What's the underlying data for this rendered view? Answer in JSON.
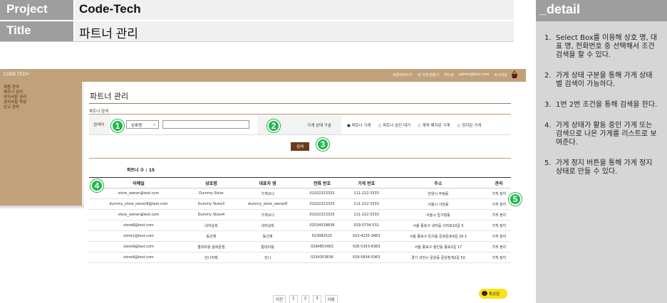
{
  "header": {
    "project_key": "Project",
    "project_val": "Code-Tech",
    "title_key": "Title",
    "title_val": "파트너 관리"
  },
  "detail": {
    "title": "_detail",
    "items": [
      {
        "num": "1.",
        "text": "Select Box를 이용해 상호 명, 대표 명, 전화번호 중 선택해서 조건 검색을 할 수 있다."
      },
      {
        "num": "2.",
        "text": "가게 상태 구분을 통해 가게 상태 별 검색이 가능하다."
      },
      {
        "num": "3.",
        "text": "1번 2번 조건을 통해 검색을 한다."
      },
      {
        "num": "4.",
        "text": "가게 상태가 활동 중인 가게 또는 검색으로 나온 가게를 리스트로 보여준다."
      },
      {
        "num": "5.",
        "text": "가게 정지 버튼을 통해 가게 정지 상태로 만들 수 있다."
      }
    ]
  },
  "app": {
    "brand": "CODE TECH",
    "nav": [
      "주문하러가기",
      "내 가게 만들기",
      "여드런",
      "admin@test.com",
      "로그아웃"
    ],
    "sidebar": [
      "회원 관리",
      "파트너 관리",
      "공지사항 관리",
      "공지사항 작성",
      "신고 관리"
    ],
    "page_title": "파트너 관리",
    "search_section": "파트너 검색",
    "search_label": "검색어",
    "select_value": "상호명",
    "status_label": "가게 상태 구분",
    "radio_options": [
      "파트너 가게",
      "파트너 승인 대기",
      "계약 해지된 가게",
      "정지된 가게"
    ],
    "search_button": "검색",
    "count_label": "파트너 수 : 15",
    "columns": [
      "이메일",
      "상호명",
      "대표자 명",
      "전화 번호",
      "가게 번호",
      "주소",
      "관리"
    ],
    "rows": [
      [
        "store_owner@test.com",
        "Dummy Store",
        "가게오너",
        "01022223333",
        "111-222-3333",
        "안양시 뚜림동",
        "가게 정지"
      ],
      [
        "dummy_store_owner8@test.com",
        "Dummy Store3",
        "dummy_store_owner8",
        "01022223333",
        "111-222-3333",
        "서울시 사당동",
        "가게 정지"
      ],
      [
        "store_owner@test.com",
        "Dummy Store4",
        "가게오너",
        "01022223333",
        "111-222-3333",
        "서울시 압구정동",
        "가게 정지"
      ],
      [
        "store8@test.com",
        "내자상회",
        "내자상회",
        "02534539636",
        "029-5734-532",
        "서울 종로구 내자동 사직로10길 3",
        "가게 정지"
      ],
      [
        "store1@test.com",
        "동선재",
        "동선재",
        "023982525",
        "023-4235-3463",
        "서울 종로구 돈의동 돈화문로9길 26-1",
        "가게 정지"
      ],
      [
        "store9@test.com",
        "황대자용 광화문점",
        "황대자용",
        "0294853463",
        "026-5353-6363",
        "서울 종로구 청진동 종로3길 17",
        "가게 정지"
      ],
      [
        "store4@test.com",
        "안나카페",
        "안나",
        "0254353636",
        "029-5834-5363",
        "경기 과천시 문원동 문원청계2길 50",
        "가게 정지"
      ]
    ],
    "pager": [
      "이전",
      "1",
      "2",
      "3",
      "다음"
    ],
    "kakao_label": "톡상담"
  },
  "markers": [
    "1",
    "2",
    "3",
    "4",
    "5"
  ],
  "colors": {
    "header_key_bg": "#9e9e9e",
    "brand_bar": "#c0a17a",
    "search_button": "#6b3a1c",
    "marker": "#1fb74a",
    "kakao": "#f7e317"
  }
}
